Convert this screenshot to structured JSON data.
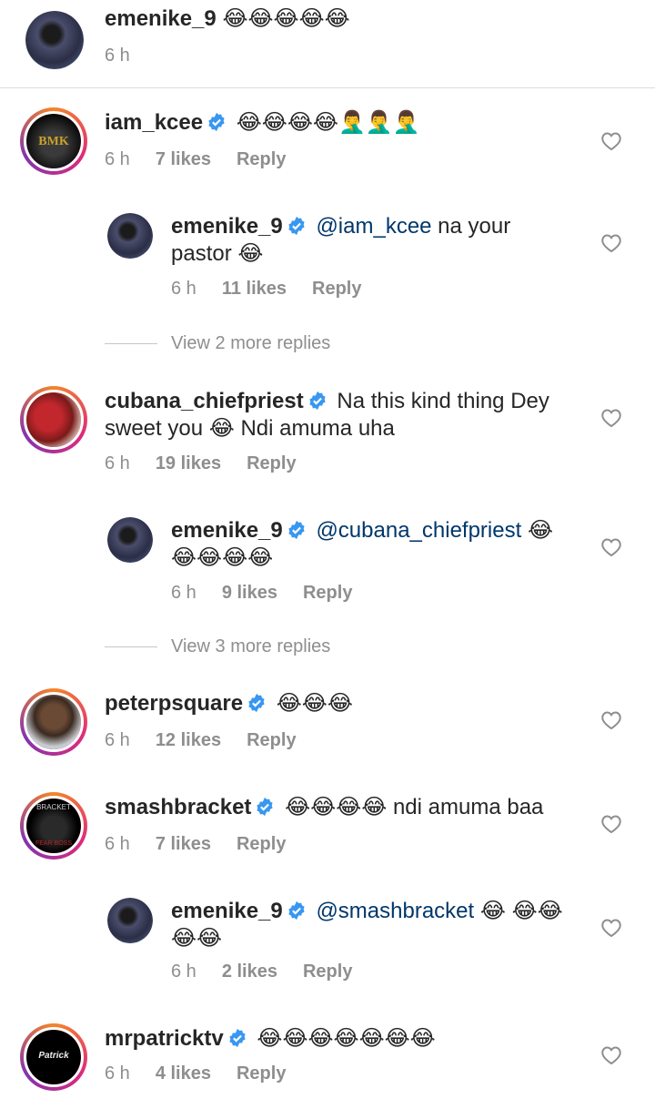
{
  "comments": [
    {
      "user": "emenike_9",
      "text": "😂😂😂😂😂",
      "time": "6 h"
    },
    {
      "user": "iam_kcee",
      "text": "😂😂😂😂🤦‍♂️🤦‍♂️🤦‍♂️",
      "time": "6 h",
      "likes": "7 likes",
      "reply": "Reply",
      "avatar_text": "BMK"
    },
    {
      "user": "emenike_9",
      "mention": "@iam_kcee",
      "text": " na your",
      "text2": "pastor 😂",
      "time": "6 h",
      "likes": "11 likes",
      "reply": "Reply"
    },
    {
      "user": "cubana_chiefpriest",
      "text": " Na this kind thing Dey",
      "text2": "sweet you 😂 Ndi amuma uha",
      "time": "6 h",
      "likes": "19 likes",
      "reply": "Reply"
    },
    {
      "user": "emenike_9",
      "mention": "@cubana_chiefpriest",
      "text": " 😂",
      "text2": "😂😂😂😂",
      "time": "6 h",
      "likes": "9 likes",
      "reply": "Reply"
    },
    {
      "user": "peterpsquare",
      "text": "😂😂😂",
      "time": "6 h",
      "likes": "12 likes",
      "reply": "Reply"
    },
    {
      "user": "smashbracket",
      "text": "😂😂😂😂 ndi amuma baa",
      "time": "6 h",
      "likes": "7 likes",
      "reply": "Reply",
      "avatar_text": "BRACKET",
      "avatar_text2": "FEAR BOSS"
    },
    {
      "user": "emenike_9",
      "mention": "@smashbracket",
      "text": " 😂 😂😂",
      "text2": "😂😂",
      "time": "6 h",
      "likes": "2 likes",
      "reply": "Reply"
    },
    {
      "user": "mrpatricktv",
      "text": "😂😂😂😂😂😂😂",
      "time": "6 h",
      "likes": "4 likes",
      "reply": "Reply",
      "avatar_text": "Patrick"
    }
  ],
  "view_more": [
    "View 2 more replies",
    "View 3 more replies"
  ],
  "colors": {
    "verified": "#3897f0",
    "mention": "#00376b",
    "meta": "#8e8e8e"
  },
  "icons": {
    "heart": "heart-outline-icon",
    "verified": "verified-badge-icon"
  }
}
